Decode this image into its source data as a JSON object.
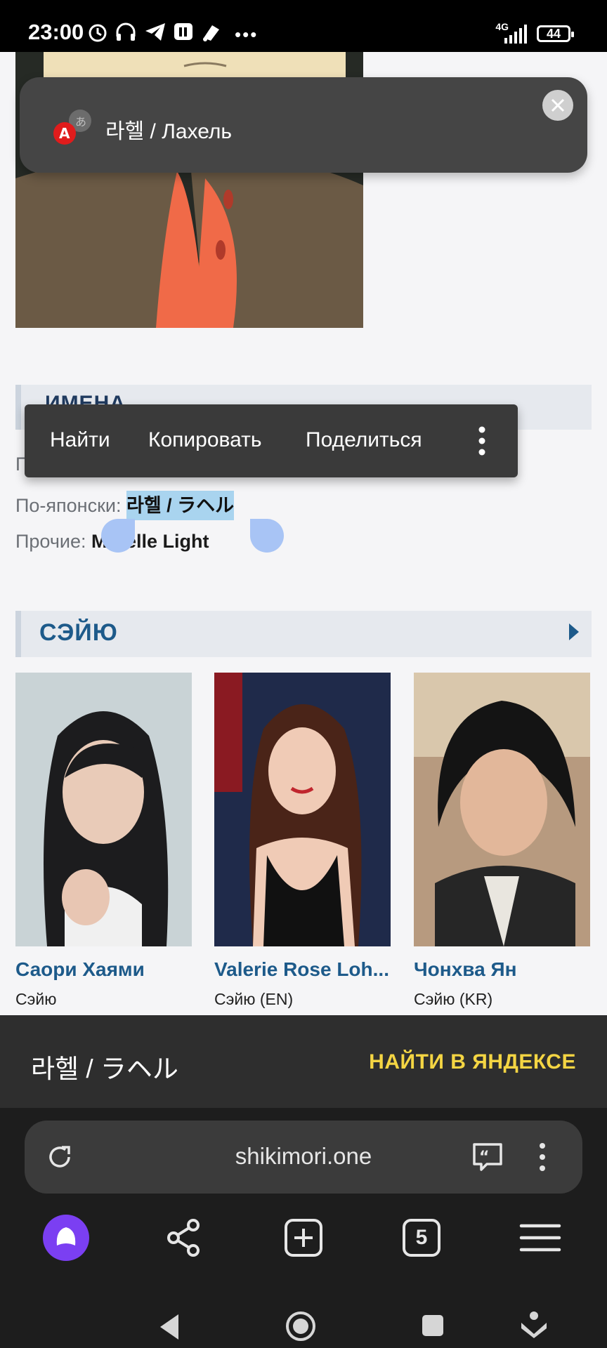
{
  "status_bar": {
    "time": "23:00",
    "network": "4G",
    "battery": "44"
  },
  "translate_popup": {
    "text": "라헬 / Лахель"
  },
  "names_section": {
    "title": "ИМЕНА"
  },
  "context_menu": {
    "find": "Найти",
    "copy": "Копировать",
    "share": "Поделиться"
  },
  "info": {
    "partial_label": "П",
    "japanese_label": "По-японски:",
    "japanese_value": "라헬 / ラヘル",
    "other_label": "Прочие:",
    "other_value_prefix": "M",
    "other_value_suffix": "helle Light"
  },
  "seiyu": {
    "title": "СЭЙЮ",
    "cards": [
      {
        "name": "Саори Хаями",
        "role": "Сэйю"
      },
      {
        "name": "Valerie Rose Loh...",
        "role": "Сэйю (EN)"
      },
      {
        "name": "Чонхва Ян",
        "role": "Сэйю (KR)"
      }
    ]
  },
  "search_strip": {
    "query": "라헬 / ラヘル",
    "action": "НАЙТИ В ЯНДЕКСЕ"
  },
  "browser": {
    "url": "shikimori.one",
    "tabs_count": "5"
  },
  "colors": {
    "accent_link": "#1d5a8a",
    "yandex_yellow": "#f4d543",
    "selection": "#a9d4ef",
    "alice_purple": "#7b3ff2"
  }
}
